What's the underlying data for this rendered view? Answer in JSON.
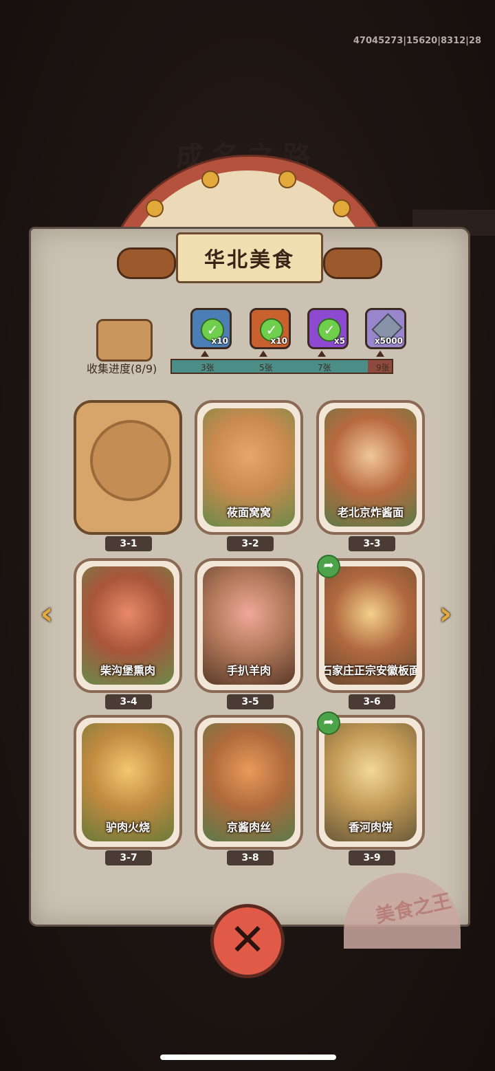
{
  "debug_info": "47045273|15620|8312|28",
  "background_title": "成名之路",
  "dialog": {
    "title": "华北美食",
    "progress_label": "收集进度(8/9)",
    "progress_fraction": 0.89,
    "rewards": [
      {
        "icon": "scroll-ticket-icon",
        "count": "x10",
        "claimed": true
      },
      {
        "icon": "key-ticket-icon",
        "count": "x10",
        "claimed": true
      },
      {
        "icon": "purple-orb-icon",
        "count": "x5",
        "claimed": true
      },
      {
        "icon": "crystal-gem-icon",
        "count": "x5000",
        "claimed": false
      }
    ],
    "milestones": [
      "3张",
      "5张",
      "7张",
      "9张"
    ],
    "cards": [
      {
        "id": "3-1",
        "name": "",
        "locked": true
      },
      {
        "id": "3-2",
        "name": "莜面窝窝",
        "locked": false,
        "color": "#c98a4e"
      },
      {
        "id": "3-3",
        "name": "老北京炸酱面",
        "locked": false,
        "color": "#b86a3e"
      },
      {
        "id": "3-4",
        "name": "柴沟堡熏肉",
        "locked": false,
        "color": "#a8553a"
      },
      {
        "id": "3-5",
        "name": "手扒羊肉",
        "locked": false,
        "color": "#b47a5c"
      },
      {
        "id": "3-6",
        "name": "石家庄正宗安徽板面",
        "locked": false,
        "color": "#b0683f",
        "share": true
      },
      {
        "id": "3-7",
        "name": "驴肉火烧",
        "locked": false,
        "color": "#c28a40"
      },
      {
        "id": "3-8",
        "name": "京酱肉丝",
        "locked": false,
        "color": "#b06a3c"
      },
      {
        "id": "3-9",
        "name": "香河肉饼",
        "locked": false,
        "color": "#c29a55",
        "share": true
      }
    ],
    "nav": {
      "prev": "‹",
      "next": "›"
    },
    "close_label": "✕",
    "stamp_text": "美食之王"
  }
}
